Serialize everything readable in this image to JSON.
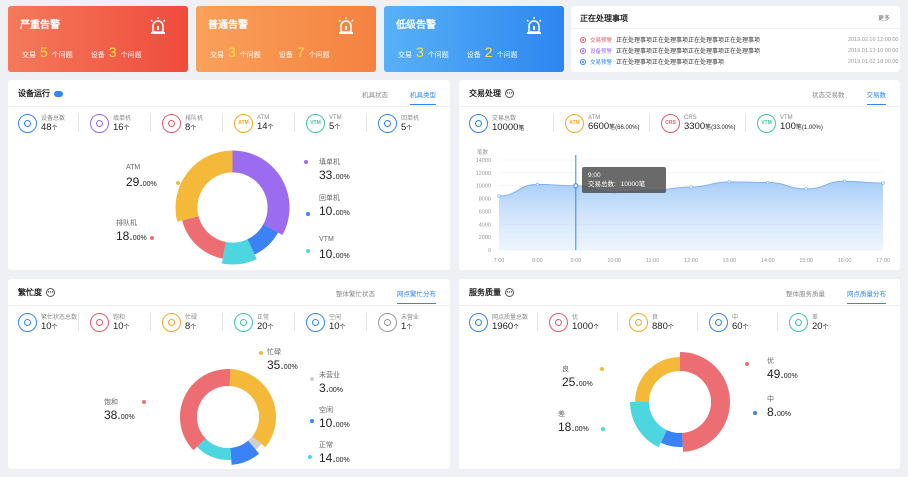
{
  "alerts": [
    {
      "title": "严重告警",
      "label_a": "交易",
      "count_a": "5",
      "unit_a": "个问题",
      "label_b": "设备",
      "count_b": "3",
      "unit_b": "个问题"
    },
    {
      "title": "普通告警",
      "label_a": "交易",
      "count_a": "3",
      "unit_a": "个问题",
      "label_b": "设备",
      "count_b": "7",
      "unit_b": "个问题"
    },
    {
      "title": "低级告警",
      "label_a": "交易",
      "count_a": "3",
      "unit_a": "个问题",
      "label_b": "设备",
      "count_b": "2",
      "unit_b": "个问题"
    }
  ],
  "processing": {
    "title": "正在处理事项",
    "more": "更多",
    "items": [
      {
        "type": "交易预警",
        "text": "正在处理事项正在处理事项正在处理事项正在处理事项",
        "time": "2019.02.16  12:00:00",
        "color": "#e85a6a"
      },
      {
        "type": "设备预警",
        "text": "正在处理事项正在处理事项正在处理事项正在处理事项",
        "time": "2019.01.13  10:00:00",
        "color": "#9b6bf0"
      },
      {
        "type": "交易预警",
        "text": "正在处理事项正在处理事项正在处理事项",
        "time": "2019.01.02  18:00:00",
        "color": "#2f86f5"
      }
    ]
  },
  "device": {
    "title": "设备运行",
    "tabs": [
      "机具状态",
      "机具类型"
    ],
    "stats": [
      {
        "label": "设备总数",
        "value": "48",
        "unit": "个",
        "icon": "device-total-icon",
        "color": "#2f86f5"
      },
      {
        "label": "填单机",
        "value": "16",
        "unit": "个",
        "icon": "form-machine-icon",
        "color": "#9b6bf0"
      },
      {
        "label": "排队机",
        "value": "8",
        "unit": "个",
        "icon": "queue-machine-icon",
        "color": "#e85a6a"
      },
      {
        "label": "ATM",
        "value": "14",
        "unit": "个",
        "icon": "ATM",
        "color": "#f5a623"
      },
      {
        "label": "VTM",
        "value": "5",
        "unit": "个",
        "icon": "VTM",
        "color": "#3cc9a0"
      },
      {
        "label": "回单机",
        "value": "5",
        "unit": "个",
        "icon": "receipt-machine-icon",
        "color": "#2f86f5"
      }
    ],
    "donut": [
      {
        "name": "填单机",
        "value": "33.",
        "dec": "00%",
        "pct": 33,
        "color": "#9b6bf0"
      },
      {
        "name": "回单机",
        "value": "10.",
        "dec": "00%",
        "pct": 10,
        "color": "#3b82f6"
      },
      {
        "name": "VTM",
        "value": "10.",
        "dec": "00%",
        "pct": 10,
        "color": "#4dd6e0"
      },
      {
        "name": "排队机",
        "value": "18.",
        "dec": "00%",
        "pct": 18,
        "color": "#ec6d72"
      },
      {
        "name": "ATM",
        "value": "29.",
        "dec": "00%",
        "pct": 29,
        "color": "#f5b93a"
      }
    ]
  },
  "trans": {
    "title": "交易处理",
    "tabs": [
      "状态交易数",
      "交易数"
    ],
    "stats": [
      {
        "label": "交易总数",
        "value": "10000",
        "unit": "笔",
        "icon": "transaction-icon",
        "color": "#2f86f5"
      },
      {
        "label": "ATM",
        "value": "6600",
        "unit": "笔(66.00%)",
        "icon": "ATM",
        "color": "#f5a623"
      },
      {
        "label": "CRS",
        "value": "3300",
        "unit": "笔(33.00%)",
        "icon": "CRS",
        "color": "#e85a6a"
      },
      {
        "label": "VTM",
        "value": "100",
        "unit": "笔(1.00%)",
        "icon": "VTM",
        "color": "#3cc9a0"
      }
    ],
    "y_unit": "笔数",
    "tooltip": {
      "time": "9:00",
      "label": "交易总数:",
      "value": "10000笔"
    }
  },
  "busy": {
    "title": "繁忙度",
    "tabs": [
      "整体繁忙状态",
      "网点繁忙分布"
    ],
    "stats": [
      {
        "label": "繁忙状态总数",
        "value": "10",
        "unit": "个",
        "icon": "busy-total-icon",
        "color": "#2f86f5"
      },
      {
        "label": "饱和",
        "value": "10",
        "unit": "个",
        "icon": "saturated-icon",
        "color": "#e85a6a"
      },
      {
        "label": "忙碌",
        "value": "8",
        "unit": "个",
        "icon": "busy-icon",
        "color": "#f5a623"
      },
      {
        "label": "正常",
        "value": "20",
        "unit": "个",
        "icon": "normal-icon",
        "color": "#3cc9a0"
      },
      {
        "label": "空闲",
        "value": "10",
        "unit": "个",
        "icon": "idle-icon",
        "color": "#2f86f5"
      },
      {
        "label": "未营业",
        "value": "1",
        "unit": "个",
        "icon": "closed-icon",
        "color": "#999999"
      }
    ],
    "donut": [
      {
        "name": "忙碌",
        "value": "35.",
        "dec": "00%",
        "pct": 35,
        "color": "#f5b93a"
      },
      {
        "name": "未营业",
        "value": "3.",
        "dec": "00%",
        "pct": 3,
        "color": "#cfcfcf"
      },
      {
        "name": "空闲",
        "value": "10.",
        "dec": "00%",
        "pct": 10,
        "color": "#3b82f6"
      },
      {
        "name": "正常",
        "value": "14.",
        "dec": "00%",
        "pct": 14,
        "color": "#4dd6e0"
      },
      {
        "name": "饱和",
        "value": "38.",
        "dec": "00%",
        "pct": 38,
        "color": "#ec6d72"
      }
    ]
  },
  "service": {
    "title": "服务质量",
    "tabs": [
      "整体服务质量",
      "网点质量分布"
    ],
    "stats": [
      {
        "label": "网点质量总数",
        "value": "1960",
        "unit": "个",
        "icon": "quality-total-icon",
        "color": "#2f86f5"
      },
      {
        "label": "优",
        "value": "1000",
        "unit": "个",
        "icon": "excellent-icon",
        "color": "#e85a6a"
      },
      {
        "label": "良",
        "value": "880",
        "unit": "个",
        "icon": "good-icon",
        "color": "#f5a623"
      },
      {
        "label": "中",
        "value": "60",
        "unit": "个",
        "icon": "medium-icon",
        "color": "#2f86f5"
      },
      {
        "label": "差",
        "value": "20",
        "unit": "个",
        "icon": "poor-icon",
        "color": "#3cc9a0"
      }
    ],
    "donut": [
      {
        "name": "优",
        "value": "49.",
        "dec": "00%",
        "pct": 49,
        "color": "#ec6d72"
      },
      {
        "name": "中",
        "value": "8.",
        "dec": "00%",
        "pct": 8,
        "color": "#3b82f6"
      },
      {
        "name": "差",
        "value": "18.",
        "dec": "00%",
        "pct": 18,
        "color": "#4dd6e0"
      },
      {
        "name": "良",
        "value": "25.",
        "dec": "00%",
        "pct": 25,
        "color": "#f5b93a"
      }
    ]
  },
  "chart_data": {
    "type": "area",
    "x": [
      "7:00",
      "8:00",
      "9:00",
      "10:00",
      "11:00",
      "12:00",
      "13:00",
      "14:00",
      "15:00",
      "16:00",
      "17:00"
    ],
    "values": [
      8400,
      10200,
      10000,
      9000,
      9300,
      9800,
      10600,
      10500,
      9500,
      10700,
      10400
    ],
    "ylim": [
      0,
      14000
    ],
    "yticks": [
      "0",
      "2000",
      "4000",
      "6000",
      "8000",
      "10000",
      "12000",
      "14000"
    ],
    "ylabel": "笔数",
    "grid": true
  }
}
